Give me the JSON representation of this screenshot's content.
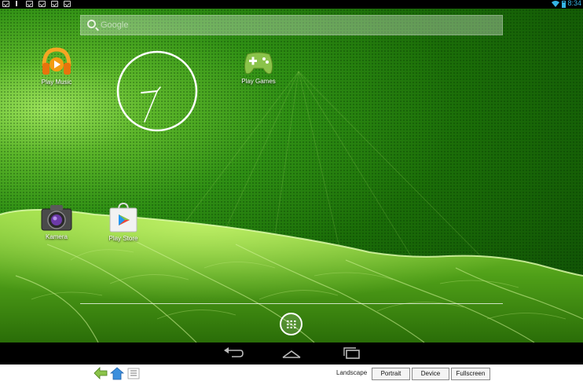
{
  "status_bar": {
    "time": "8:34",
    "notification_icons": [
      "notification-icon",
      "signal-tick-icon",
      "checkbox-icon",
      "checkbox-icon",
      "checkbox-icon",
      "checkbox-icon"
    ],
    "accent_color": "#34b5e5"
  },
  "search": {
    "placeholder": "Google",
    "icon": "search-icon"
  },
  "apps": [
    {
      "label": "Play Music",
      "icon": "headphones-icon"
    },
    {
      "label": "Play Games",
      "icon": "gamepad-icon"
    },
    {
      "label": "Kamera",
      "icon": "camera-icon"
    },
    {
      "label": "Play Store",
      "icon": "shopping-bag-icon"
    }
  ],
  "widgets": {
    "analog_clock": "analog-clock"
  },
  "dock": {
    "app_drawer_icon": "apps-grid-icon"
  },
  "nav_bar": {
    "back_icon": "back-icon",
    "home_icon": "home-icon",
    "recents_icon": "recent-apps-icon"
  },
  "host_toolbar": {
    "icons": [
      "back-arrow-icon",
      "home-arrow-icon",
      "menu-list-icon"
    ],
    "mode_label": "Landscape",
    "buttons": [
      "Portrait",
      "Device",
      "Fullscreen"
    ]
  },
  "colors": {
    "wallpaper_light": "#9be25a",
    "wallpaper_dark": "#0d4a04",
    "accent": "#34b5e5"
  }
}
